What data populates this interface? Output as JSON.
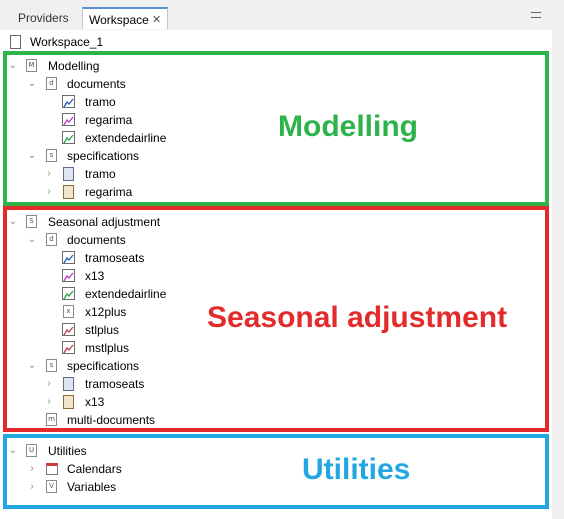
{
  "tabs": [
    {
      "label": "Providers",
      "active": false
    },
    {
      "label": "Workspace",
      "active": true,
      "close": "✕"
    }
  ],
  "workspace": {
    "label": "Workspace_1"
  },
  "tree": {
    "modelling": {
      "label": "Modelling",
      "icon": "M",
      "documents": {
        "label": "documents",
        "items": [
          "tramo",
          "regarima",
          "extendedairline"
        ]
      },
      "specifications": {
        "label": "specifications",
        "items": [
          "tramo",
          "regarima"
        ]
      }
    },
    "seasonal": {
      "label": "Seasonal adjustment",
      "icon": "S",
      "documents": {
        "label": "documents",
        "items": [
          "tramoseats",
          "x13",
          "extendedairline",
          "x12plus",
          "stlplus",
          "mstlplus"
        ]
      },
      "specifications": {
        "label": "specifications",
        "items": [
          "tramoseats",
          "x13"
        ]
      },
      "multi": {
        "label": "multi-documents"
      }
    },
    "utilities": {
      "label": "Utilities",
      "icon": "U",
      "items": [
        "Calendars",
        "Variables"
      ]
    }
  },
  "annotations": {
    "modelling": "Modelling",
    "seasonal": "Seasonal adjustment",
    "utilities": "Utilities"
  },
  "colors": {
    "modelling_box": "#2db34a",
    "seasonal_box": "#e32b2b",
    "utilities_box": "#22a7e0",
    "active_tab_accent": "#5a8fd0"
  }
}
